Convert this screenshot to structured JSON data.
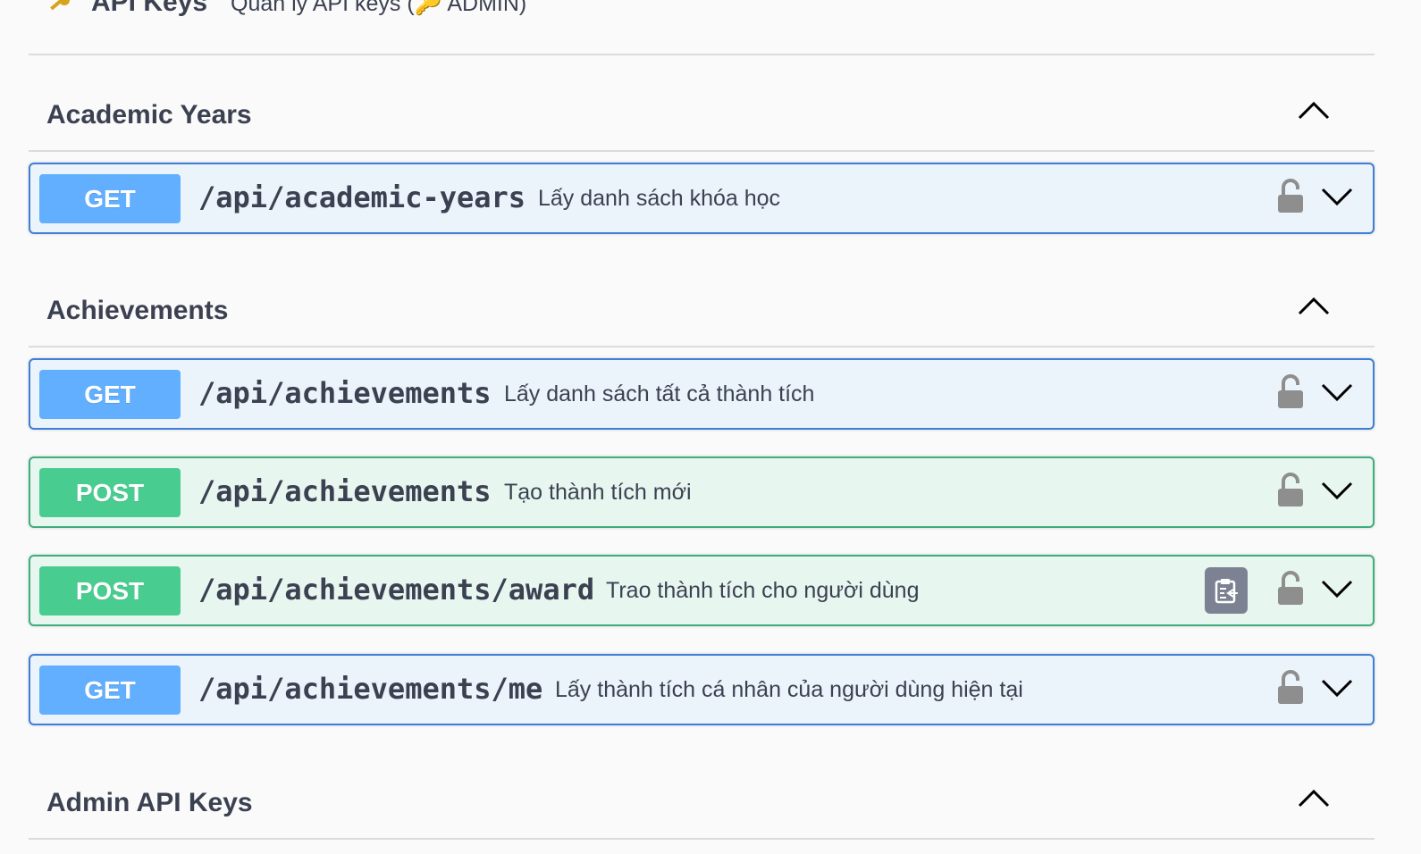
{
  "sections": {
    "api_keys": {
      "title": "API Keys",
      "description": "Quản lý API keys (🔑 ADMIN)"
    },
    "academic_years": {
      "title": "Academic Years",
      "operations": [
        {
          "method": "GET",
          "path": "/api/academic-years",
          "summary": "Lấy danh sách khóa học"
        }
      ]
    },
    "achievements": {
      "title": "Achievements",
      "operations": [
        {
          "method": "GET",
          "path": "/api/achievements",
          "summary": "Lấy danh sách tất cả thành tích"
        },
        {
          "method": "POST",
          "path": "/api/achievements",
          "summary": "Tạo thành tích mới"
        },
        {
          "method": "POST",
          "path": "/api/achievements/award",
          "summary": "Trao thành tích cho người dùng"
        },
        {
          "method": "GET",
          "path": "/api/achievements/me",
          "summary": "Lấy thành tích cá nhân của người dùng hiện tại"
        }
      ]
    },
    "admin_api_keys": {
      "title": "Admin API Keys"
    }
  },
  "icons": {
    "section_toggle": "chevron-up-icon",
    "operation_toggle": "chevron-down-icon",
    "auth": "unlocked-padlock-icon",
    "copy": "clipboard-copy-icon"
  },
  "colors": {
    "get": "#61affe",
    "post": "#49cc90",
    "get_bg": "#ebf3fb",
    "post_bg": "#e8f6f0",
    "text": "#3b4151"
  }
}
